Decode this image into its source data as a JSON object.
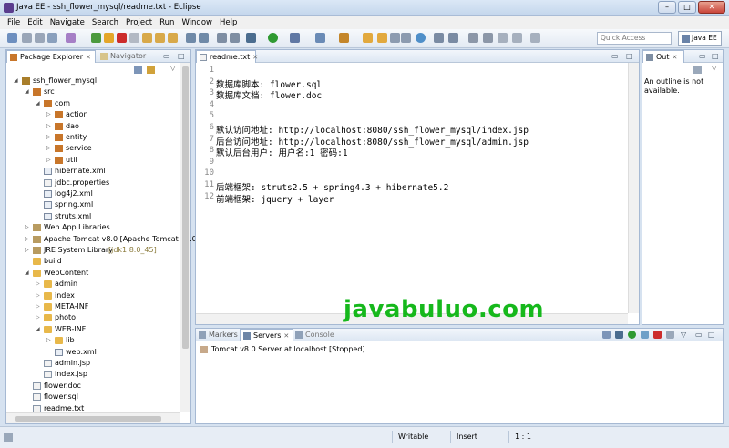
{
  "window": {
    "title": "Java EE - ssh_flower_mysql/readme.txt - Eclipse"
  },
  "menu": [
    "File",
    "Edit",
    "Navigate",
    "Search",
    "Project",
    "Run",
    "Window",
    "Help"
  ],
  "quick_access": {
    "placeholder": "Quick Access"
  },
  "perspective": {
    "label": "Java EE"
  },
  "package_explorer": {
    "tab_label": "Package Explorer",
    "navigator_label": "Navigator",
    "tree": [
      {
        "label": "ssh_flower_mysql",
        "icon": "project-icon",
        "arrow": "down"
      },
      {
        "label": "src",
        "icon": "source-folder-icon",
        "arrow": "down"
      },
      {
        "label": "com",
        "icon": "package-icon",
        "arrow": "down"
      },
      {
        "label": "action",
        "icon": "package-icon",
        "arrow": "right"
      },
      {
        "label": "dao",
        "icon": "package-icon",
        "arrow": "right"
      },
      {
        "label": "entity",
        "icon": "package-icon",
        "arrow": "right"
      },
      {
        "label": "service",
        "icon": "package-icon",
        "arrow": "right"
      },
      {
        "label": "util",
        "icon": "package-icon",
        "arrow": "right"
      },
      {
        "label": "hibernate.xml",
        "icon": "xml-file-icon",
        "arrow": ""
      },
      {
        "label": "jdbc.properties",
        "icon": "file-icon",
        "arrow": ""
      },
      {
        "label": "log4j2.xml",
        "icon": "xml-file-icon",
        "arrow": ""
      },
      {
        "label": "spring.xml",
        "icon": "xml-file-icon",
        "arrow": ""
      },
      {
        "label": "struts.xml",
        "icon": "xml-file-icon",
        "arrow": ""
      },
      {
        "label": "Web App Libraries",
        "icon": "library-icon",
        "arrow": "right"
      },
      {
        "label": "Apache Tomcat v8.0 [Apache Tomcat v8.0",
        "icon": "library-icon",
        "arrow": "right"
      },
      {
        "label": "JRE System Library",
        "deco": "[jdk1.8.0_45]",
        "icon": "library-icon",
        "arrow": "right"
      },
      {
        "label": "build",
        "icon": "folder-icon",
        "arrow": ""
      },
      {
        "label": "WebContent",
        "icon": "folder-icon",
        "arrow": "down"
      },
      {
        "label": "admin",
        "icon": "folder-icon",
        "arrow": "right"
      },
      {
        "label": "index",
        "icon": "folder-icon",
        "arrow": "right"
      },
      {
        "label": "META-INF",
        "icon": "folder-icon",
        "arrow": "right"
      },
      {
        "label": "photo",
        "icon": "folder-icon",
        "arrow": "right"
      },
      {
        "label": "WEB-INF",
        "icon": "folder-icon",
        "arrow": "down"
      },
      {
        "label": "lib",
        "icon": "folder-icon",
        "arrow": "right"
      },
      {
        "label": "web.xml",
        "icon": "xml-file-icon",
        "arrow": ""
      },
      {
        "label": "admin.jsp",
        "icon": "file-icon",
        "arrow": ""
      },
      {
        "label": "index.jsp",
        "icon": "file-icon",
        "arrow": ""
      },
      {
        "label": "flower.doc",
        "icon": "file-icon",
        "arrow": ""
      },
      {
        "label": "flower.sql",
        "icon": "file-icon",
        "arrow": ""
      },
      {
        "label": "readme.txt",
        "icon": "file-icon",
        "arrow": ""
      }
    ]
  },
  "editor": {
    "tab_label": "readme.txt",
    "lines": [
      {
        "n": "1",
        "text": ""
      },
      {
        "n": "2",
        "text": "数据库脚本: flower.sql"
      },
      {
        "n": "3",
        "text": "数据库文档: flower.doc"
      },
      {
        "n": "4",
        "text": ""
      },
      {
        "n": "5",
        "text": ""
      },
      {
        "n": "6",
        "text": "默认访问地址: http://localhost:8080/ssh_flower_mysql/index.jsp"
      },
      {
        "n": "7",
        "text": "后台访问地址: http://localhost:8080/ssh_flower_mysql/admin.jsp"
      },
      {
        "n": "8",
        "text": "默认后台用户: 用户名:1 密码:1"
      },
      {
        "n": "9",
        "text": ""
      },
      {
        "n": "10",
        "text": ""
      },
      {
        "n": "11",
        "text": "后端框架: struts2.5 + spring4.3 + hibernate5.2"
      },
      {
        "n": "12",
        "text": "前端框架: jquery + layer"
      }
    ]
  },
  "outline": {
    "tab_label": "Out",
    "message": "An outline is not available."
  },
  "bottom": {
    "tabs": [
      "Markers",
      "Servers",
      "Console"
    ],
    "server_row": "Tomcat v8.0 Server at localhost  [Stopped]"
  },
  "watermark": "javabuluo.com",
  "status": {
    "writable": "Writable",
    "insert": "Insert",
    "position": "1 : 1"
  }
}
